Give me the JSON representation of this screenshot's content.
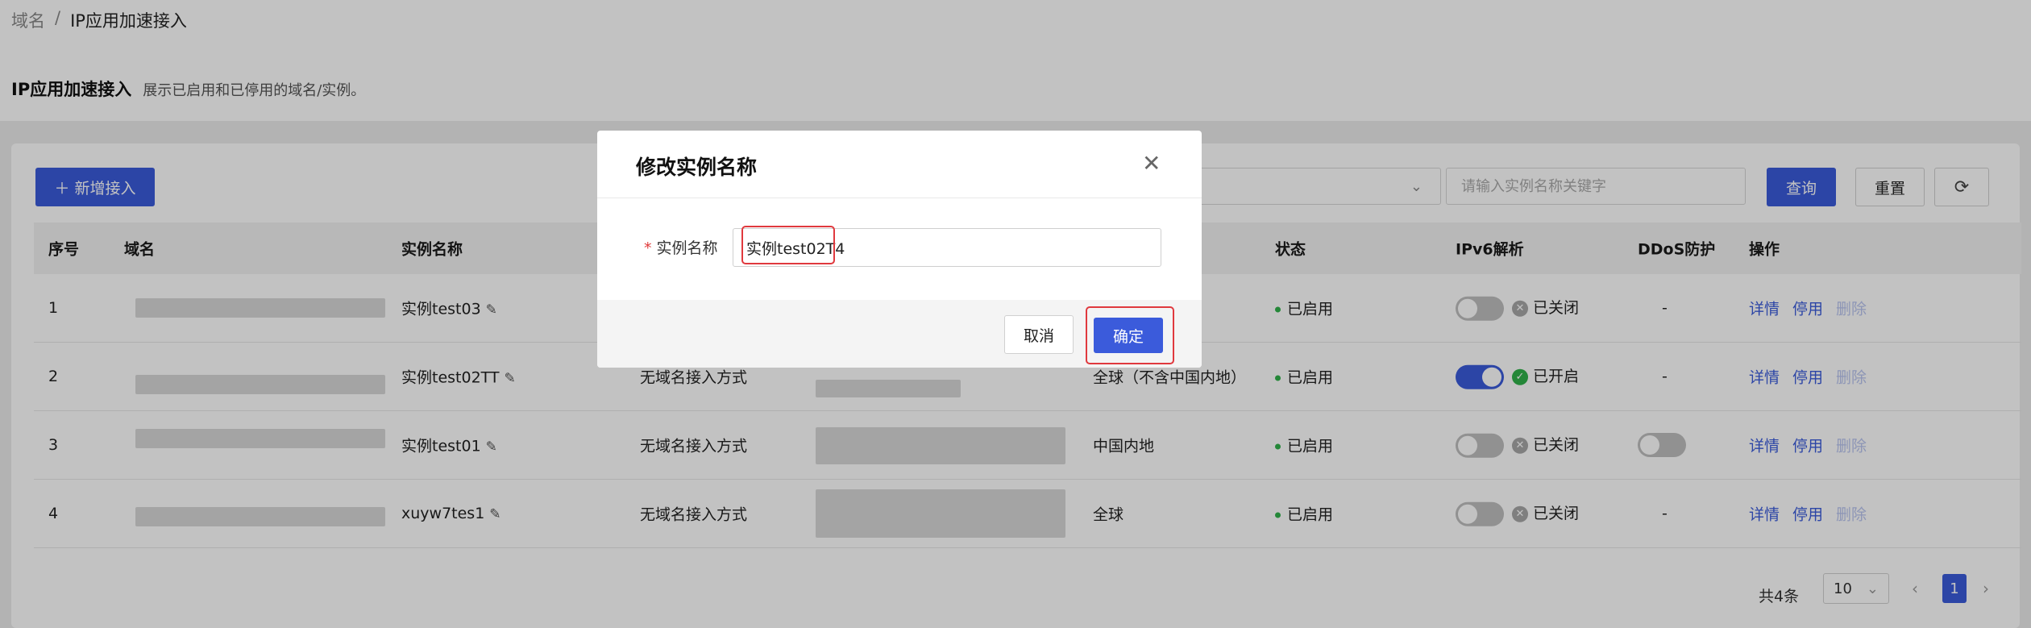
{
  "breadcrumb": {
    "root": "域名",
    "sep": "/",
    "current": "IP应用加速接入"
  },
  "header": {
    "title": "IP应用加速接入",
    "description": "展示已启用和已停用的域名/实例。"
  },
  "toolbar": {
    "add_label": "新增接入",
    "search_placeholder": "请输入实例名称关键字",
    "query_label": "查询",
    "reset_label": "重置"
  },
  "table": {
    "headers": [
      "序号",
      "域名",
      "实例名称",
      "",
      "",
      "",
      "状态",
      "IPv6解析",
      "DDoS防护",
      "操作"
    ],
    "rows": [
      {
        "index": "1",
        "name": "实例test03",
        "access": "",
        "cidr": "",
        "region": "",
        "status": "已启用",
        "ipv6_on": false,
        "ipv6_text": "已关闭",
        "ddos": "-",
        "ddos_switch": false
      },
      {
        "index": "2",
        "name": "实例test02TT",
        "access": "无域名接入方式",
        "cidr": "",
        "region": "全球（不含中国内地）",
        "status": "已启用",
        "ipv6_on": true,
        "ipv6_text": "已开启",
        "ddos": "-",
        "ddos_switch": false
      },
      {
        "index": "3",
        "name": "实例test01",
        "access": "无域名接入方式",
        "cidr": "",
        "region": "中国内地",
        "status": "已启用",
        "ipv6_on": false,
        "ipv6_text": "已关闭",
        "ddos": "",
        "ddos_switch": true
      },
      {
        "index": "4",
        "name": "xuyw7tes1",
        "access": "无域名接入方式",
        "cidr": "",
        "region": "全球",
        "status": "已启用",
        "ipv6_on": false,
        "ipv6_text": "已关闭",
        "ddos": "-",
        "ddos_switch": false
      }
    ],
    "actions": {
      "detail": "详情",
      "disable": "停用",
      "delete": "删除"
    }
  },
  "pagination": {
    "total_text": "共4条",
    "page_size": "10",
    "current_page": "1"
  },
  "modal": {
    "title": "修改实例名称",
    "field_label": "实例名称",
    "required_mark": "*",
    "field_value": "实例test02T4",
    "cancel_label": "取消",
    "ok_label": "确定"
  },
  "colors": {
    "primary": "#3b5bdb",
    "success": "#30b24a",
    "highlight": "#e0393e"
  }
}
